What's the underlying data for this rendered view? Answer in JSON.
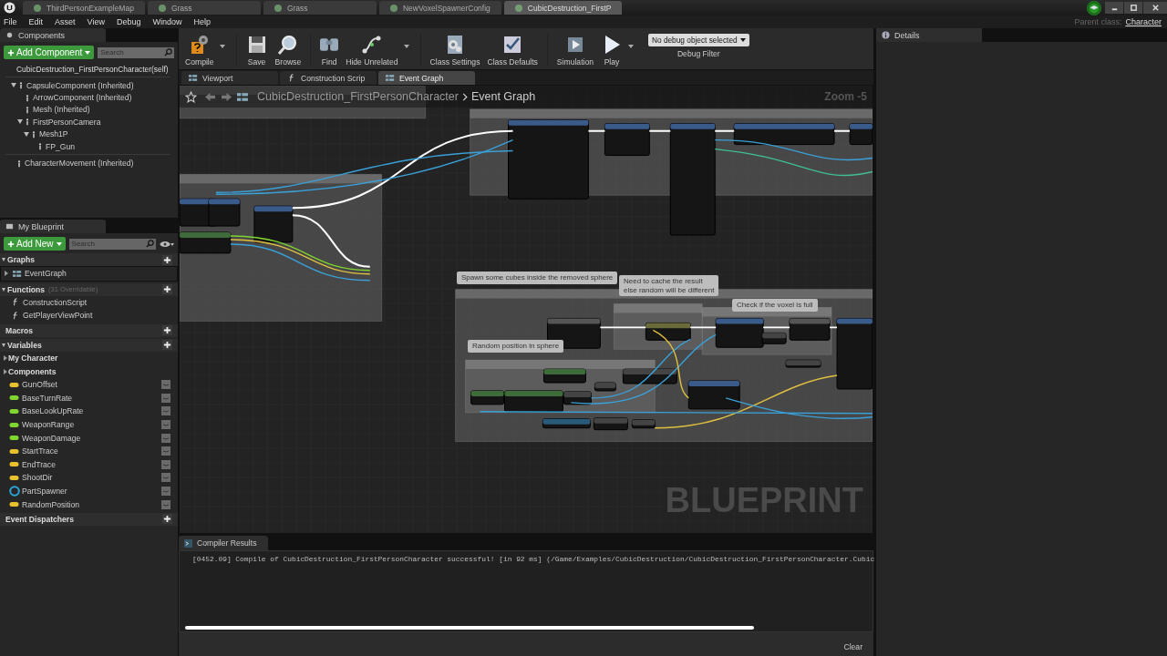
{
  "tabs": [
    {
      "label": "ThirdPersonExampleMap",
      "selected": false
    },
    {
      "label": "Grass",
      "selected": false
    },
    {
      "label": "Grass",
      "selected": false
    },
    {
      "label": "NewVoxelSpawnerConfig",
      "selected": false
    },
    {
      "label": "CubicDestruction_FirstP",
      "selected": true
    }
  ],
  "menu": [
    "File",
    "Edit",
    "Asset",
    "View",
    "Debug",
    "Window",
    "Help"
  ],
  "parent_class": {
    "label": "Parent class:",
    "value": "Character"
  },
  "components": {
    "title": "Components",
    "add_button": "Add Component",
    "search_placeholder": "Search",
    "root": "CubicDestruction_FirstPersonCharacter(self)",
    "tree": [
      {
        "label": "CapsuleComponent (Inherited)",
        "expanded": true,
        "children": [
          {
            "label": "ArrowComponent (Inherited)"
          },
          {
            "label": "Mesh (Inherited)"
          },
          {
            "label": "FirstPersonCamera",
            "expanded": true,
            "children": [
              {
                "label": "Mesh1P",
                "expanded": true,
                "children": [
                  {
                    "label": "FP_Gun"
                  }
                ]
              }
            ]
          }
        ]
      }
    ],
    "extra": [
      {
        "label": "CharacterMovement (Inherited)"
      }
    ]
  },
  "my_blueprint": {
    "title": "My Blueprint",
    "add_button": "Add New",
    "search_placeholder": "Search",
    "sections": [
      {
        "title": "Graphs",
        "expanded": true,
        "items": [
          {
            "label": "EventGraph",
            "kind": "graph"
          }
        ]
      },
      {
        "title": "Functions",
        "note": "(31 Overridable)",
        "expanded": true,
        "items": [
          {
            "label": "ConstructionScript",
            "kind": "function"
          },
          {
            "label": "GetPlayerViewPoint",
            "kind": "function"
          }
        ]
      },
      {
        "title": "Macros"
      },
      {
        "title": "Variables",
        "expanded": true,
        "items": [
          {
            "label": "My Character",
            "kind": "category"
          },
          {
            "label": "Components",
            "kind": "category"
          },
          {
            "label": "GunOffset",
            "kind": "variable",
            "color": "#e8c22e"
          },
          {
            "label": "BaseTurnRate",
            "kind": "variable",
            "color": "#7ed62e"
          },
          {
            "label": "BaseLookUpRate",
            "kind": "variable",
            "color": "#7ed62e"
          },
          {
            "label": "WeaponRange",
            "kind": "variable",
            "color": "#7ed62e"
          },
          {
            "label": "WeaponDamage",
            "kind": "variable",
            "color": "#7ed62e"
          },
          {
            "label": "StartTrace",
            "kind": "variable",
            "color": "#e8c22e"
          },
          {
            "label": "EndTrace",
            "kind": "variable",
            "color": "#e8c22e"
          },
          {
            "label": "ShootDir",
            "kind": "variable",
            "color": "#e8c22e"
          },
          {
            "label": "PartSpawner",
            "kind": "object",
            "color": "#2aa7d6"
          },
          {
            "label": "RandomPosition",
            "kind": "variable",
            "color": "#e8c22e"
          }
        ]
      },
      {
        "title": "Event Dispatchers"
      }
    ]
  },
  "toolbar": [
    {
      "label": "Compile",
      "has_menu": true
    },
    {
      "label": "Save",
      "has_menu": false
    },
    {
      "label": "Browse",
      "has_menu": false
    },
    {
      "label": "Find",
      "has_menu": false
    },
    {
      "label": "Hide Unrelated",
      "has_menu": true
    },
    {
      "label": "Class Settings",
      "has_menu": false
    },
    {
      "label": "Class Defaults",
      "has_menu": false
    },
    {
      "label": "Simulation",
      "has_menu": false
    },
    {
      "label": "Play",
      "has_menu": true
    }
  ],
  "debug_filter": {
    "value": "No debug object selected",
    "label": "Debug Filter"
  },
  "editor_tabs": [
    {
      "label": "Viewport",
      "selected": false
    },
    {
      "label": "Construction Scrip",
      "selected": false
    },
    {
      "label": "Event Graph",
      "selected": true
    }
  ],
  "breadcrumb": [
    "CubicDestruction_FirstPersonCharacter",
    "Event Graph"
  ],
  "zoom": "Zoom -5",
  "graph_label": "BLUEPRINT",
  "comments": [
    {
      "text": "Spawn some cubes inside the removed sphere"
    },
    {
      "text": "Need to cache the result\nelse random will be different"
    },
    {
      "text": "Check if the voxel is full"
    },
    {
      "text": "Random position in sphere"
    }
  ],
  "compiler": {
    "title": "Compiler Results",
    "messages": [
      "[0452.09] Compile of CubicDestruction_FirstPersonCharacter successful! [in 92 ms] (/Game/Examples/CubicDestruction/CubicDestruction_FirstPersonCharacter.Cubic"
    ],
    "clear": "Clear"
  },
  "details": {
    "title": "Details"
  }
}
